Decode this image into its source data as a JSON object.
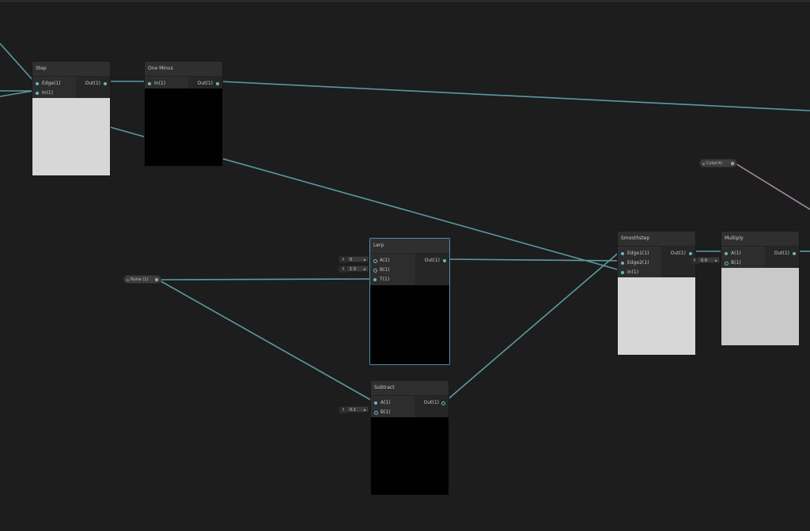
{
  "colors": {
    "background": "#1d1d1d",
    "wire": "#5a9aa0",
    "wire_pink": "#a88aa6",
    "node_body": "#2b2b2b",
    "port": "#6ab5c4"
  },
  "properties": {
    "color_prop": {
      "label": "Color(4)"
    },
    "noise_prop": {
      "label": "Noise (1)"
    }
  },
  "nodes": {
    "step": {
      "title": "Step",
      "in": [
        "Edge(1)",
        "In(1)"
      ],
      "out": [
        "Out(1)"
      ],
      "preview": "white"
    },
    "one_minus": {
      "title": "One Minus",
      "in": [
        "In(1)"
      ],
      "out": [
        "Out(1)"
      ],
      "preview": "black"
    },
    "lerp": {
      "title": "Lerp",
      "in": [
        "A(1)",
        "B(1)",
        "T(1)"
      ],
      "out": [
        "Out(1)"
      ],
      "preview": "black",
      "fields": [
        {
          "label": "X",
          "value": "0"
        },
        {
          "label": "X",
          "value": "1.3"
        }
      ]
    },
    "subtract": {
      "title": "Subtract",
      "in": [
        "A(1)",
        "B(1)"
      ],
      "out": [
        "Out(1)"
      ],
      "preview": "black",
      "fields": [
        {
          "label": "X",
          "value": "0.1"
        }
      ]
    },
    "smoothstep": {
      "title": "Smoothstep",
      "in": [
        "Edge1(1)",
        "Edge2(1)",
        "In(1)"
      ],
      "out": [
        "Out(1)"
      ],
      "preview": "white"
    },
    "multiply": {
      "title": "Multiply",
      "in": [
        "A(1)",
        "B(1)"
      ],
      "out": [
        "Out(1)"
      ],
      "preview": "white",
      "fields": [
        {
          "label": "X",
          "value": "0.9"
        }
      ]
    }
  }
}
